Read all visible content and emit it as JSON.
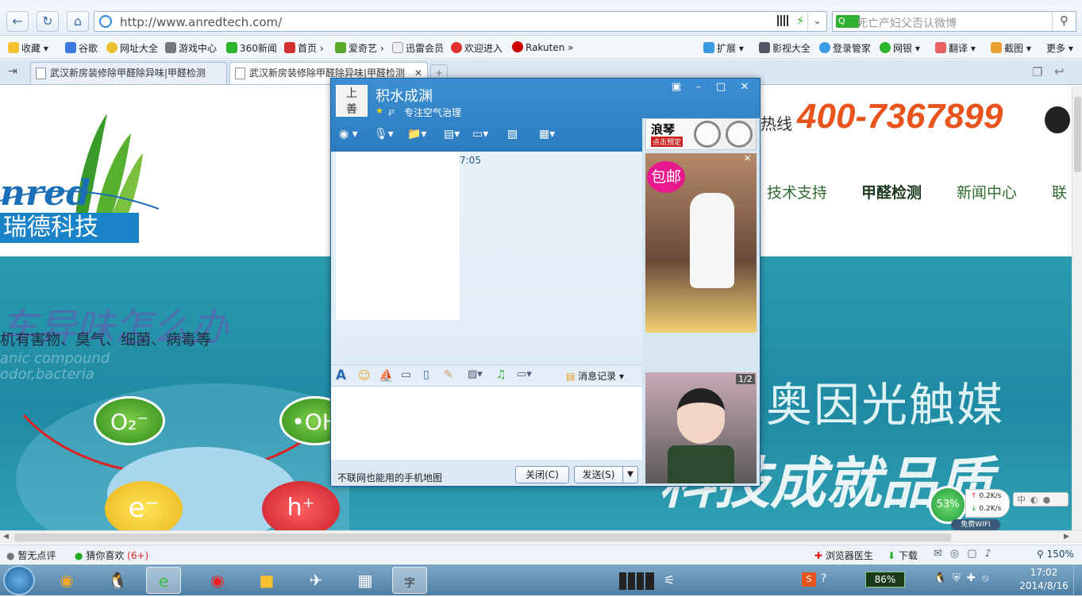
{
  "browser": {
    "address_url": "http://www.anredtech.com/",
    "search_placeholder": "死亡产妇父否认微博",
    "bookmarks": [
      "收藏",
      "谷歌",
      "网址大全",
      "游戏中心",
      "360新闻",
      "首页",
      "爱奇艺",
      "迅雷会员",
      "欢迎进入",
      "Rakuten"
    ],
    "bookmarks_right": [
      "扩展",
      "影视大全",
      "登录管家",
      "网银",
      "翻译",
      "截图",
      "更多"
    ],
    "tabs": [
      "武汉新房装修除甲醛除异味|甲醛检测",
      "武汉新房装修除甲醛除异味|甲醛检测"
    ],
    "status_left": [
      "暂无点评",
      "猜你喜欢",
      "(6+)"
    ],
    "status_right": [
      "浏览器医生",
      "下载",
      "150%"
    ],
    "network": {
      "percent": "53%",
      "up": "0.2K/s",
      "down": "0.2K/s",
      "wifi": "免费WIFI"
    }
  },
  "website": {
    "logo_text": "nred",
    "logo_cn": "瑞德科技",
    "hotline_label": "热线",
    "hotline": "400-7367899",
    "nav": [
      "技术支持",
      "甲醛检测",
      "新闻中心",
      "联"
    ],
    "banner_title": "车异味怎么办",
    "banner_sub": "机有害物、臭气、细菌、病毒等",
    "banner_en1": "anic compound",
    "banner_en2": "odor,bacteria",
    "circles": [
      "O₂⁻",
      "•OH",
      "e⁻",
      "h⁺"
    ],
    "slogan": "奥因光触媒",
    "slogan2": "科技成就品质"
  },
  "qq": {
    "name": "积水成渊",
    "signature": "专注空气治理",
    "message_time": "7:05",
    "history_label": "消息记录",
    "footer_tip": "不联网也能用的手机地图",
    "close_label": "关闭(C)",
    "send_label": "发送(S)",
    "ad_top": "浪琴",
    "ad_top_sub": "点击预定",
    "ad_badge": "包邮",
    "ad_counter": "1/2"
  },
  "taskbar": {
    "battery": "86%",
    "time": "17:02",
    "date": "2014/8/16"
  }
}
